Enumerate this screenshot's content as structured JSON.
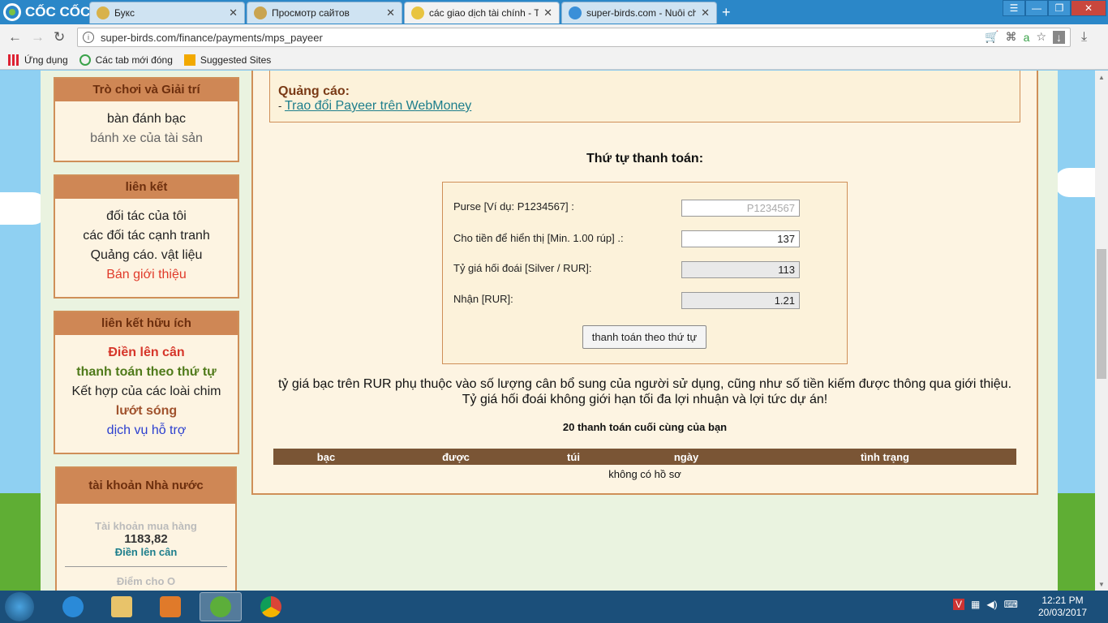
{
  "browser": {
    "brand": "CỐC CỐC",
    "tabs": [
      {
        "title": "Букс",
        "icon_color": "#d8b24a",
        "active": false
      },
      {
        "title": "Просмотр сайтов",
        "icon_color": "#c9a450",
        "active": false
      },
      {
        "title": "các giao dịch tài chính - Th",
        "icon_color": "#e8c440",
        "active": true
      },
      {
        "title": "super-birds.com - Nuôi ch",
        "icon_color": "#3a8fd8",
        "active": false
      }
    ],
    "url": "super-birds.com/finance/payments/mps_payeer",
    "bookmarks": [
      {
        "label": "Ứng dụng",
        "icon": "apps-grid-icon"
      },
      {
        "label": "Các tab mới đóng",
        "icon": "recent-tabs-icon"
      },
      {
        "label": "Suggested Sites",
        "icon": "bing-icon"
      }
    ]
  },
  "sidebar": {
    "games": {
      "title": "Trò chơi và Giải trí",
      "items": [
        {
          "label": "bàn đánh bạc",
          "color": "#222222"
        },
        {
          "label": "bánh xe của tài sản",
          "color": "#666666"
        }
      ]
    },
    "links": {
      "title": "liên kết",
      "items": [
        {
          "label": "đối tác của tôi",
          "color": "#222222"
        },
        {
          "label": "các đối tác cạnh tranh",
          "color": "#222222"
        },
        {
          "label": "Quảng cáo. vật liệu",
          "color": "#222222"
        },
        {
          "label": "Bán giới thiệu",
          "color": "#e03a2a"
        }
      ]
    },
    "useful": {
      "title": "liên kết hữu ích",
      "items": [
        {
          "label": "Điền lên cân",
          "color": "#d6362a",
          "bold": true
        },
        {
          "label": "thanh toán theo thứ tự",
          "color": "#4f7a1a",
          "bold": true
        },
        {
          "label": "Kết hợp của các loài chim",
          "color": "#222222",
          "bold": false
        },
        {
          "label": "lướt sóng",
          "color": "#a0522d",
          "bold": true
        },
        {
          "label": "dịch vụ hỗ trợ",
          "color": "#2a3ecf",
          "bold": false
        }
      ]
    },
    "state_account": {
      "title": "tài khoản Nhà nước",
      "purchase_label": "Tài khoản mua hàng",
      "purchase_value": "1183,82",
      "topup_link": "Điền lên cân",
      "points_label": "Điểm cho O"
    }
  },
  "ad": {
    "title": "Quảng cáo:",
    "prefix": "- ",
    "link": "Trao đổi Payeer trên WebMoney"
  },
  "payment": {
    "title": "Thứ tự thanh toán:",
    "purse_label": "Purse [Ví dụ: P1234567] :",
    "purse_placeholder": "P1234567",
    "amount_label": "Cho tiền để hiển thị [Min. 1.00 rúp] .:",
    "amount_value": "137",
    "rate_label": "Tỷ giá hối đoái [Silver / RUR]:",
    "rate_value": "113",
    "receive_label": "Nhận [RUR]:",
    "receive_value": "1.21",
    "submit": "thanh toán theo thứ tự"
  },
  "note": {
    "line1": "tỷ giá bạc trên RUR phụ thuộc vào số lượng cân bổ sung của người sử dụng, cũng như số tiền kiếm được thông qua giới thiệu.",
    "line2": "Tỷ giá hối đoái không giới hạn tối đa lợi nhuận và lợi tức dự án!"
  },
  "history": {
    "title": "20 thanh toán cuối cùng của bạn",
    "columns": [
      "bạc",
      "được",
      "túi",
      "ngày",
      "tình trạng"
    ],
    "empty": "không có hồ sơ"
  },
  "taskbar": {
    "time": "12:21 PM",
    "date": "20/03/2017"
  },
  "colors": {
    "box_border": "#cf8f58",
    "box_header": "#cf8755",
    "table_header": "#7a5535"
  }
}
